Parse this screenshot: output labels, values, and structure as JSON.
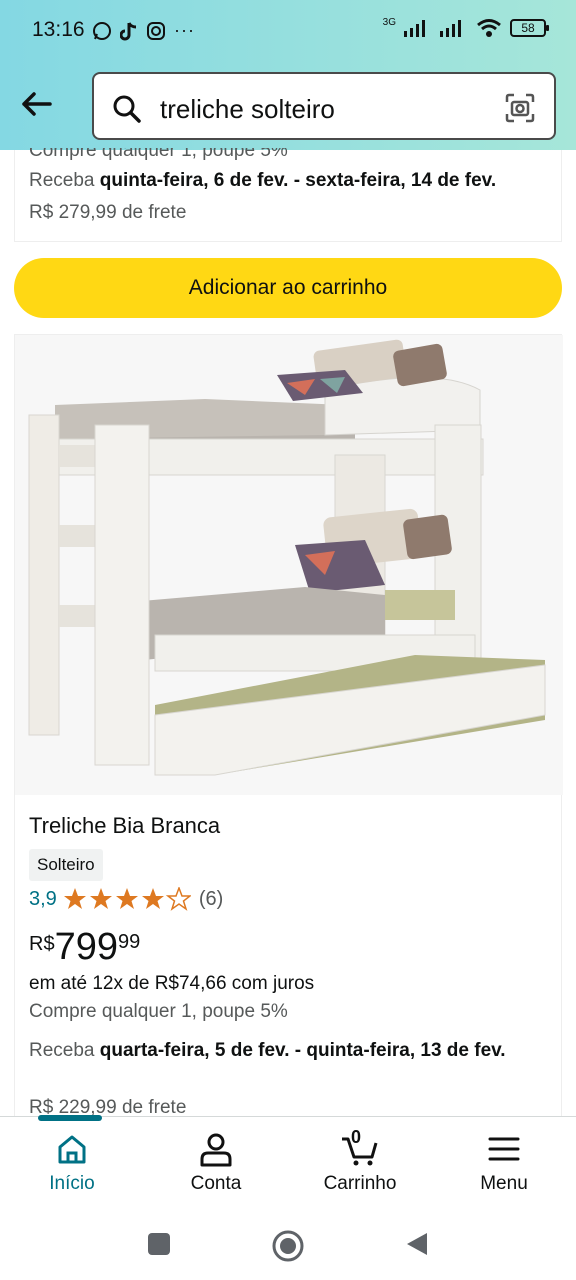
{
  "status_bar": {
    "time": "13:16",
    "network": "3G",
    "battery": "58"
  },
  "search": {
    "query": "treliche solteiro"
  },
  "previous_result": {
    "cut_text": "Compre qualquer 1, poupe 5%",
    "delivery_prefix": "Receba ",
    "delivery_dates": "quinta-feira, 6 de fev. - sexta-feira, 14 de fev.",
    "freight": "R$ 279,99 de frete",
    "add_to_cart": "Adicionar ao carrinho"
  },
  "product": {
    "title": "Treliche Bia Branca",
    "badge": "Solteiro",
    "rating": "3,9",
    "rating_value": 3.9,
    "review_count": "(6)",
    "price_currency": "R$",
    "price_integer": "799",
    "price_cents": "99",
    "installments": "em até 12x de R$74,66 com juros",
    "promo": "Compre qualquer 1, poupe 5%",
    "delivery_prefix": "Receba ",
    "delivery_dates": "quarta-feira, 5 de fev. - quinta-feira, 13 de fev.",
    "freight": "R$ 229,99 de frete"
  },
  "bottom_nav": {
    "items": [
      {
        "label": "Início",
        "icon": "home-icon",
        "active": true
      },
      {
        "label": "Conta",
        "icon": "person-icon",
        "active": false
      },
      {
        "label": "Carrinho",
        "icon": "cart-icon",
        "active": false,
        "count": "0"
      },
      {
        "label": "Menu",
        "icon": "menu-icon",
        "active": false
      }
    ]
  },
  "colors": {
    "header_start": "#84d8e3",
    "header_end": "#a6e6d9",
    "cart_button": "#ffd814",
    "link_teal": "#007185",
    "star": "#de7921"
  }
}
